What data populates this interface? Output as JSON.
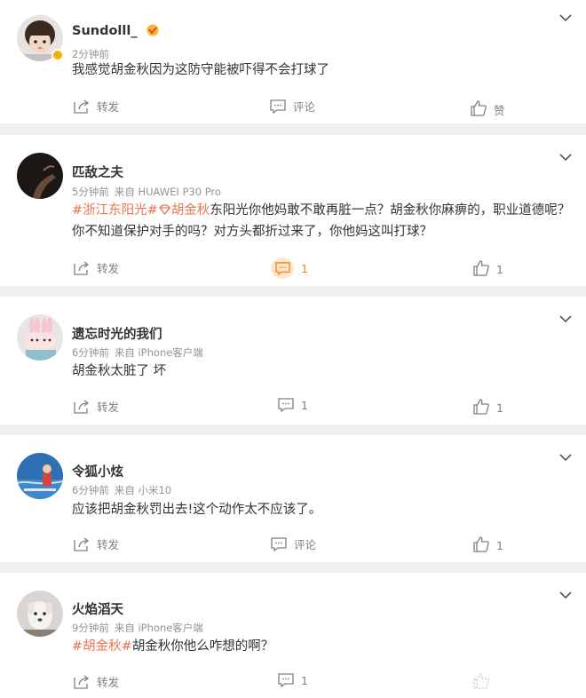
{
  "posts": [
    {
      "username": "Sundolll_",
      "time": "2分钟前",
      "source": "",
      "segments": [
        {
          "text": "我感觉胡金秋因为这防守能被吓得不会打球了",
          "tag": false
        }
      ],
      "share_label": "转发",
      "comment_label": "评论",
      "like_label": "赞"
    },
    {
      "username": "匹敌之夫",
      "time": "5分钟前",
      "source": "来自 HUAWEI P30 Pro",
      "segments": [
        {
          "text": "#浙江东阳光#",
          "tag": true
        },
        {
          "text": "胡金秋",
          "tag": true
        },
        {
          "text": "东阳光你他妈敢不敢再脏一点？胡金秋你麻痹的，职业道德呢？你不知道保护对手的吗？对方头都折过来了，你他妈这叫打球？",
          "tag": false
        }
      ],
      "share_label": "转发",
      "comment_label": "1",
      "like_label": "1"
    },
    {
      "username": "遗忘时光的我们",
      "time": "6分钟前",
      "source": "来自 iPhone客户端",
      "segments": [
        {
          "text": "胡金秋太脏了 坏",
          "tag": false
        }
      ],
      "share_label": "转发",
      "comment_label": "1",
      "like_label": "1"
    },
    {
      "username": "令狐小炫",
      "time": "6分钟前",
      "source": "来自 小米10",
      "segments": [
        {
          "text": "应该把胡金秋罚出去!这个动作太不应该了。",
          "tag": false
        }
      ],
      "share_label": "转发",
      "comment_label": "评论",
      "like_label": "1"
    },
    {
      "username": "火焰滔天",
      "time": "9分钟前",
      "source": "来自 iPhone客户端",
      "segments": [
        {
          "text": "#胡金秋#",
          "tag": true
        },
        {
          "text": "胡金秋你他么咋想的啊？",
          "tag": false
        }
      ],
      "share_label": "转发",
      "comment_label": "1",
      "like_label": ""
    }
  ],
  "colors": {
    "topic": "#eb7350",
    "highlight": "#ff8200",
    "meta": "#939393"
  },
  "icons": [
    "chevron-down-icon",
    "share-icon",
    "comment-icon",
    "like-icon",
    "vip-icon",
    "verified-badge-icon",
    "location-icon"
  ]
}
